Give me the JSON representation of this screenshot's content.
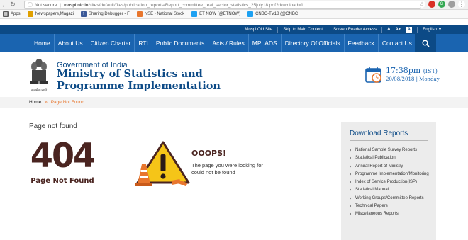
{
  "browser": {
    "secure_label": "Not secure",
    "url_host": "mospi.nic.in",
    "url_path": "/sites/default/files/publication_reports/Report_committee_real_sector_statistics_25july18.pdf?download=1",
    "bookmarks": [
      {
        "label": "Apps",
        "color": "#5a5a5a"
      },
      {
        "label": "Newspapers,Magazi",
        "color": "#e0a000"
      },
      {
        "label": "Sharing Debugger - F",
        "color": "#3b5998"
      },
      {
        "label": "NSE - National Stock",
        "color": "#e8762d"
      },
      {
        "label": "ET NOW (@ETNOW)",
        "color": "#1da1f2"
      },
      {
        "label": "CNBC-TV18 (@CNBC",
        "color": "#1da1f2"
      }
    ]
  },
  "utility": {
    "old_site": "Mospi Old Site",
    "skip": "Skip to Main Content",
    "reader": "Screen Reader Access",
    "font_small": "A",
    "font_plus": "A+",
    "font_minus": "A-",
    "contrast": "A",
    "language": "English",
    "language_caret": "▾"
  },
  "nav": {
    "items": [
      "Home",
      "About Us",
      "Citizen Charter",
      "RTI",
      "Public Documents",
      "Acts / Rules",
      "MPLADS",
      "Directory Of Officials",
      "Feedback",
      "Contact Us"
    ]
  },
  "header": {
    "gov": "Government of India",
    "ministry_line1": "Ministry of Statistics and",
    "ministry_line2": "Programme Implementation",
    "emblem_caption": "सत्यमेव जयते",
    "time": "17:38pm",
    "time_zone": "(IST)",
    "date": "20/08/2018 | Monday"
  },
  "breadcrumb": {
    "home": "Home",
    "arrow": "»",
    "current": "Page Not Found"
  },
  "content": {
    "title": "Page not found",
    "code": "404",
    "code_sub": "Page Not Found",
    "oops": "OOOPS!",
    "message": "The page you were looking for could not be found"
  },
  "sidebar": {
    "title": "Download Reports",
    "items": [
      "National Sample Survey Reports",
      "Statistical Publication",
      "Annual Report of Ministry",
      "Programme Implementation/Monitoring",
      "Index of Service Production(ISP)",
      "Statistical Manual",
      "Working Groups/Committee Reports",
      "Technical Papers",
      "Miscellaneous Reports"
    ]
  },
  "colors": {
    "nav_bg": "#1a64b0",
    "utility_bg": "#0c4a86",
    "accent_orange": "#e8762d",
    "error_brown": "#4a2420",
    "warning_yellow": "#f5c518"
  }
}
